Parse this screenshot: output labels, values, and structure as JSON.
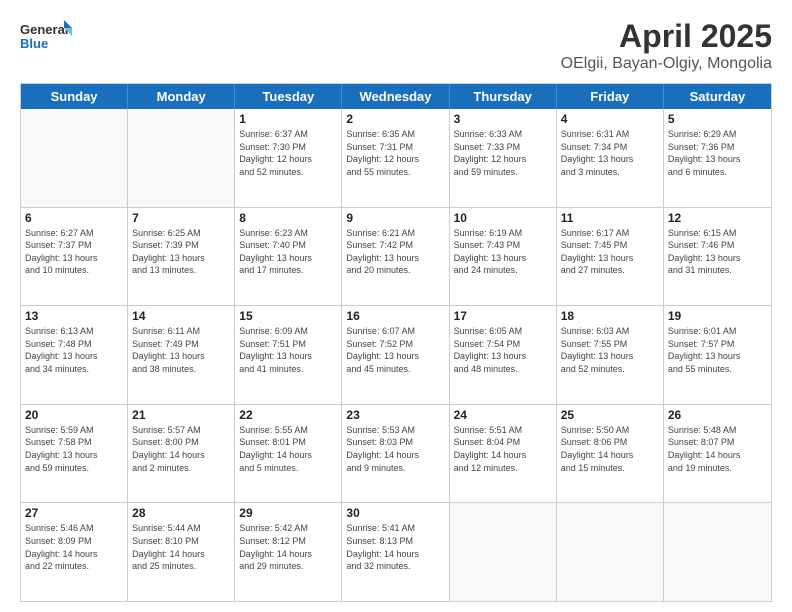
{
  "logo": {
    "line1": "General",
    "line2": "Blue"
  },
  "title": "April 2025",
  "location": "OElgii, Bayan-Olgiy, Mongolia",
  "weekdays": [
    "Sunday",
    "Monday",
    "Tuesday",
    "Wednesday",
    "Thursday",
    "Friday",
    "Saturday"
  ],
  "weeks": [
    [
      {
        "day": "",
        "info": ""
      },
      {
        "day": "",
        "info": ""
      },
      {
        "day": "1",
        "info": "Sunrise: 6:37 AM\nSunset: 7:30 PM\nDaylight: 12 hours\nand 52 minutes."
      },
      {
        "day": "2",
        "info": "Sunrise: 6:35 AM\nSunset: 7:31 PM\nDaylight: 12 hours\nand 55 minutes."
      },
      {
        "day": "3",
        "info": "Sunrise: 6:33 AM\nSunset: 7:33 PM\nDaylight: 12 hours\nand 59 minutes."
      },
      {
        "day": "4",
        "info": "Sunrise: 6:31 AM\nSunset: 7:34 PM\nDaylight: 13 hours\nand 3 minutes."
      },
      {
        "day": "5",
        "info": "Sunrise: 6:29 AM\nSunset: 7:36 PM\nDaylight: 13 hours\nand 6 minutes."
      }
    ],
    [
      {
        "day": "6",
        "info": "Sunrise: 6:27 AM\nSunset: 7:37 PM\nDaylight: 13 hours\nand 10 minutes."
      },
      {
        "day": "7",
        "info": "Sunrise: 6:25 AM\nSunset: 7:39 PM\nDaylight: 13 hours\nand 13 minutes."
      },
      {
        "day": "8",
        "info": "Sunrise: 6:23 AM\nSunset: 7:40 PM\nDaylight: 13 hours\nand 17 minutes."
      },
      {
        "day": "9",
        "info": "Sunrise: 6:21 AM\nSunset: 7:42 PM\nDaylight: 13 hours\nand 20 minutes."
      },
      {
        "day": "10",
        "info": "Sunrise: 6:19 AM\nSunset: 7:43 PM\nDaylight: 13 hours\nand 24 minutes."
      },
      {
        "day": "11",
        "info": "Sunrise: 6:17 AM\nSunset: 7:45 PM\nDaylight: 13 hours\nand 27 minutes."
      },
      {
        "day": "12",
        "info": "Sunrise: 6:15 AM\nSunset: 7:46 PM\nDaylight: 13 hours\nand 31 minutes."
      }
    ],
    [
      {
        "day": "13",
        "info": "Sunrise: 6:13 AM\nSunset: 7:48 PM\nDaylight: 13 hours\nand 34 minutes."
      },
      {
        "day": "14",
        "info": "Sunrise: 6:11 AM\nSunset: 7:49 PM\nDaylight: 13 hours\nand 38 minutes."
      },
      {
        "day": "15",
        "info": "Sunrise: 6:09 AM\nSunset: 7:51 PM\nDaylight: 13 hours\nand 41 minutes."
      },
      {
        "day": "16",
        "info": "Sunrise: 6:07 AM\nSunset: 7:52 PM\nDaylight: 13 hours\nand 45 minutes."
      },
      {
        "day": "17",
        "info": "Sunrise: 6:05 AM\nSunset: 7:54 PM\nDaylight: 13 hours\nand 48 minutes."
      },
      {
        "day": "18",
        "info": "Sunrise: 6:03 AM\nSunset: 7:55 PM\nDaylight: 13 hours\nand 52 minutes."
      },
      {
        "day": "19",
        "info": "Sunrise: 6:01 AM\nSunset: 7:57 PM\nDaylight: 13 hours\nand 55 minutes."
      }
    ],
    [
      {
        "day": "20",
        "info": "Sunrise: 5:59 AM\nSunset: 7:58 PM\nDaylight: 13 hours\nand 59 minutes."
      },
      {
        "day": "21",
        "info": "Sunrise: 5:57 AM\nSunset: 8:00 PM\nDaylight: 14 hours\nand 2 minutes."
      },
      {
        "day": "22",
        "info": "Sunrise: 5:55 AM\nSunset: 8:01 PM\nDaylight: 14 hours\nand 5 minutes."
      },
      {
        "day": "23",
        "info": "Sunrise: 5:53 AM\nSunset: 8:03 PM\nDaylight: 14 hours\nand 9 minutes."
      },
      {
        "day": "24",
        "info": "Sunrise: 5:51 AM\nSunset: 8:04 PM\nDaylight: 14 hours\nand 12 minutes."
      },
      {
        "day": "25",
        "info": "Sunrise: 5:50 AM\nSunset: 8:06 PM\nDaylight: 14 hours\nand 15 minutes."
      },
      {
        "day": "26",
        "info": "Sunrise: 5:48 AM\nSunset: 8:07 PM\nDaylight: 14 hours\nand 19 minutes."
      }
    ],
    [
      {
        "day": "27",
        "info": "Sunrise: 5:46 AM\nSunset: 8:09 PM\nDaylight: 14 hours\nand 22 minutes."
      },
      {
        "day": "28",
        "info": "Sunrise: 5:44 AM\nSunset: 8:10 PM\nDaylight: 14 hours\nand 25 minutes."
      },
      {
        "day": "29",
        "info": "Sunrise: 5:42 AM\nSunset: 8:12 PM\nDaylight: 14 hours\nand 29 minutes."
      },
      {
        "day": "30",
        "info": "Sunrise: 5:41 AM\nSunset: 8:13 PM\nDaylight: 14 hours\nand 32 minutes."
      },
      {
        "day": "",
        "info": ""
      },
      {
        "day": "",
        "info": ""
      },
      {
        "day": "",
        "info": ""
      }
    ]
  ]
}
